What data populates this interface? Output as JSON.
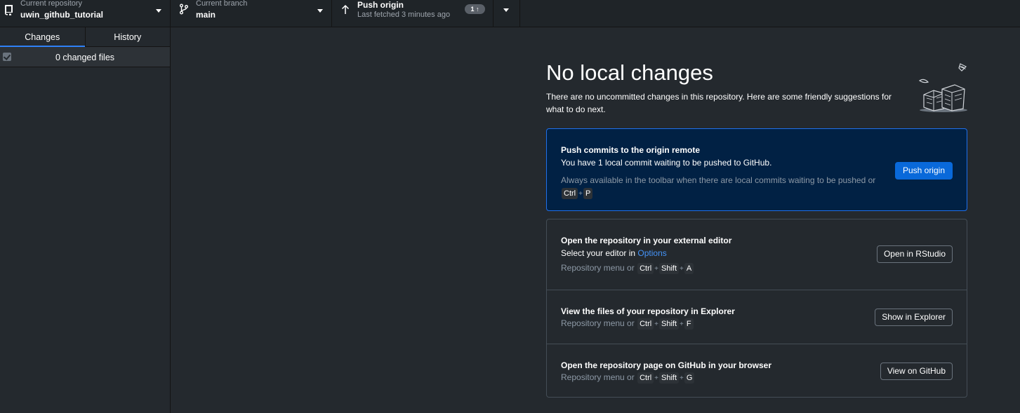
{
  "toolbar": {
    "repo": {
      "label": "Current repository",
      "value": "uwin_github_tutorial"
    },
    "branch": {
      "label": "Current branch",
      "value": "main"
    },
    "push": {
      "label": "Push origin",
      "sub": "Last fetched 3 minutes ago",
      "badge": "1 ↑"
    }
  },
  "sidebar": {
    "tabs": [
      "Changes",
      "History"
    ],
    "changes_label": "0 changed files"
  },
  "main": {
    "title": "No local changes",
    "subtitle": "There are no uncommitted changes in this repository. Here are some friendly suggestions for what to do next.",
    "push_card": {
      "title": "Push commits to the origin remote",
      "desc": "You have 1 local commit waiting to be pushed to GitHub.",
      "hint": "Always available in the toolbar when there are local commits waiting to be pushed or",
      "keys": [
        "Ctrl",
        "P"
      ],
      "button": "Push origin"
    },
    "rows": [
      {
        "title": "Open the repository in your external editor",
        "desc_prefix": "Select your editor in ",
        "desc_link": "Options",
        "hint": "Repository menu or",
        "keys": [
          "Ctrl",
          "Shift",
          "A"
        ],
        "button": "Open in RStudio"
      },
      {
        "title": "View the files of your repository in Explorer",
        "hint": "Repository menu or",
        "keys": [
          "Ctrl",
          "Shift",
          "F"
        ],
        "button": "Show in Explorer"
      },
      {
        "title": "Open the repository page on GitHub in your browser",
        "hint": "Repository menu or",
        "keys": [
          "Ctrl",
          "Shift",
          "G"
        ],
        "button": "View on GitHub"
      }
    ],
    "key_separator": "+"
  }
}
